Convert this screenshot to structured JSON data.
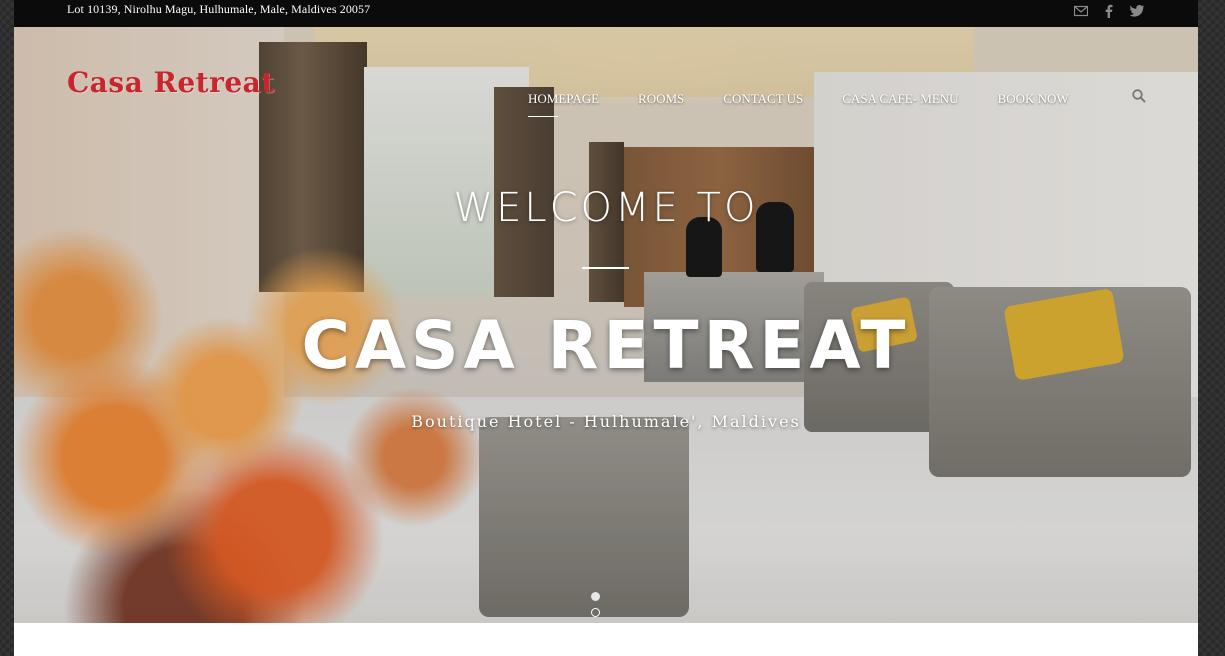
{
  "topbar": {
    "address": "Lot 10139, Nirolhu Magu, Hulhumale, Male, Maldives 20057",
    "icons": [
      "mail-icon",
      "facebook-icon",
      "twitter-icon"
    ]
  },
  "header": {
    "logo": "Casa Retreat",
    "nav": [
      {
        "label": "HOMEPAGE",
        "active": true
      },
      {
        "label": "ROOMS"
      },
      {
        "label": "CONTACT US"
      },
      {
        "label": "CASA CAFE- MENU"
      },
      {
        "label": "BOOK NOW"
      }
    ]
  },
  "hero": {
    "welcome": "WELCOME TO",
    "title": "CASA RETREAT",
    "subtitle": "Boutique Hotel - Hulhumale', Maldives",
    "slides_count": 2,
    "active_slide": 1
  },
  "colors": {
    "brand": "#c8252e",
    "topbar": "#0b0b0b",
    "text_on_hero": "#ffffff"
  }
}
